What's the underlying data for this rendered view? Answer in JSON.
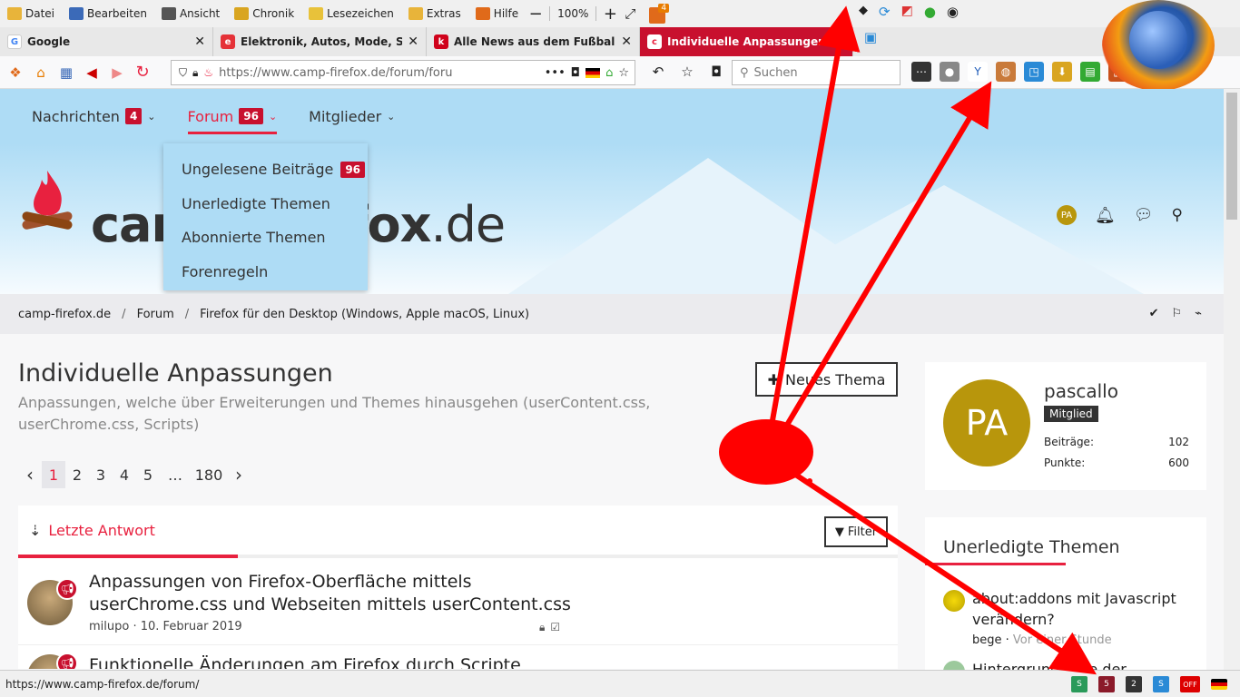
{
  "menubar": {
    "items": [
      {
        "label": "Datei",
        "icon": "folder-icon",
        "color": "#e8b43a"
      },
      {
        "label": "Bearbeiten",
        "icon": "edit-icon",
        "color": "#3b6ab8"
      },
      {
        "label": "Ansicht",
        "icon": "eye-icon",
        "color": "#555555"
      },
      {
        "label": "Chronik",
        "icon": "history-icon",
        "color": "#d9a520"
      },
      {
        "label": "Lesezeichen",
        "icon": "bookmark-icon",
        "color": "#e8c23a"
      },
      {
        "label": "Extras",
        "icon": "tools-icon",
        "color": "#e8b43a"
      },
      {
        "label": "Hilfe",
        "icon": "help-icon",
        "color": "#e06a1a"
      }
    ],
    "zoom": "100%",
    "addon_count": "4"
  },
  "tabs": [
    {
      "title": "Google",
      "favicon": "G",
      "color": "#4285f4",
      "active": false
    },
    {
      "title": "Elektronik, Autos, Mode, Samm",
      "favicon": "e",
      "color": "#e53238",
      "active": false
    },
    {
      "title": "Alle News aus dem Fußball und",
      "favicon": "k",
      "color": "#d0021b",
      "active": false
    },
    {
      "title": "Individuelle Anpassungen - ca",
      "favicon": "c",
      "color": "#e8213f",
      "active": true
    }
  ],
  "navbar": {
    "url": "https://www.camp-firefox.de/forum/foru",
    "search_placeholder": "Suchen"
  },
  "forum_nav": [
    {
      "label": "Nachrichten",
      "count": "4",
      "active": false
    },
    {
      "label": "Forum",
      "count": "96",
      "active": true
    },
    {
      "label": "Mitglieder",
      "count": "",
      "active": false
    }
  ],
  "logo": {
    "name": "camp-firefox",
    "tld": ".de",
    "avatar_initials": "PA"
  },
  "dropdown": [
    {
      "label": "Ungelesene Beiträge",
      "count": "96"
    },
    {
      "label": "Unerledigte Themen",
      "count": ""
    },
    {
      "label": "Abonnierte Themen",
      "count": ""
    },
    {
      "label": "Forenregeln",
      "count": ""
    }
  ],
  "breadcrumb": [
    "camp-firefox.de",
    "Forum",
    "Firefox für den Desktop (Windows, Apple macOS, Linux)"
  ],
  "page": {
    "title": "Individuelle Anpassungen",
    "description": "Anpassungen, welche über Erweiterungen und Themes hinausgehen (userContent.css, userChrome.css, Scripts)",
    "new_thread": "Neues Thema"
  },
  "pagination": [
    "1",
    "2",
    "3",
    "4",
    "5",
    "…",
    "180"
  ],
  "thread_list": {
    "sort_label": "Letzte Antwort",
    "filter_label": "Filter",
    "threads": [
      {
        "title": "Anpassungen von Firefox-Oberfläche mittels userChrome.css und Webseiten mittels userContent.css",
        "author": "milupo",
        "date": "10. Februar 2019"
      },
      {
        "title": "Funktionelle Änderungen am Firefox durch Scripte",
        "author": "",
        "date": ""
      }
    ]
  },
  "profile": {
    "initials": "PA",
    "name": "pascallo",
    "role": "Mitglied",
    "stats": [
      {
        "label": "Beiträge:",
        "value": "102"
      },
      {
        "label": "Punkte:",
        "value": "600"
      }
    ]
  },
  "sidebar": {
    "title": "Unerledigte Themen",
    "items": [
      {
        "title": "about:addons mit Javascript verändern?",
        "author": "bege",
        "time": "Vor einer Stunde"
      },
      {
        "title": "Hintergrundfarbe der",
        "author": "",
        "time": ""
      }
    ]
  },
  "statusbar": {
    "url": "https://www.camp-firefox.de/forum/",
    "badge_a": "5",
    "badge_b": "2",
    "off_label": "OFF"
  },
  "colors": {
    "accent": "#e8213f",
    "count_bg": "#c8102e",
    "nav_bg": "#aedcf5",
    "avatar": "#b8960c",
    "annotation": "#ff0000"
  }
}
